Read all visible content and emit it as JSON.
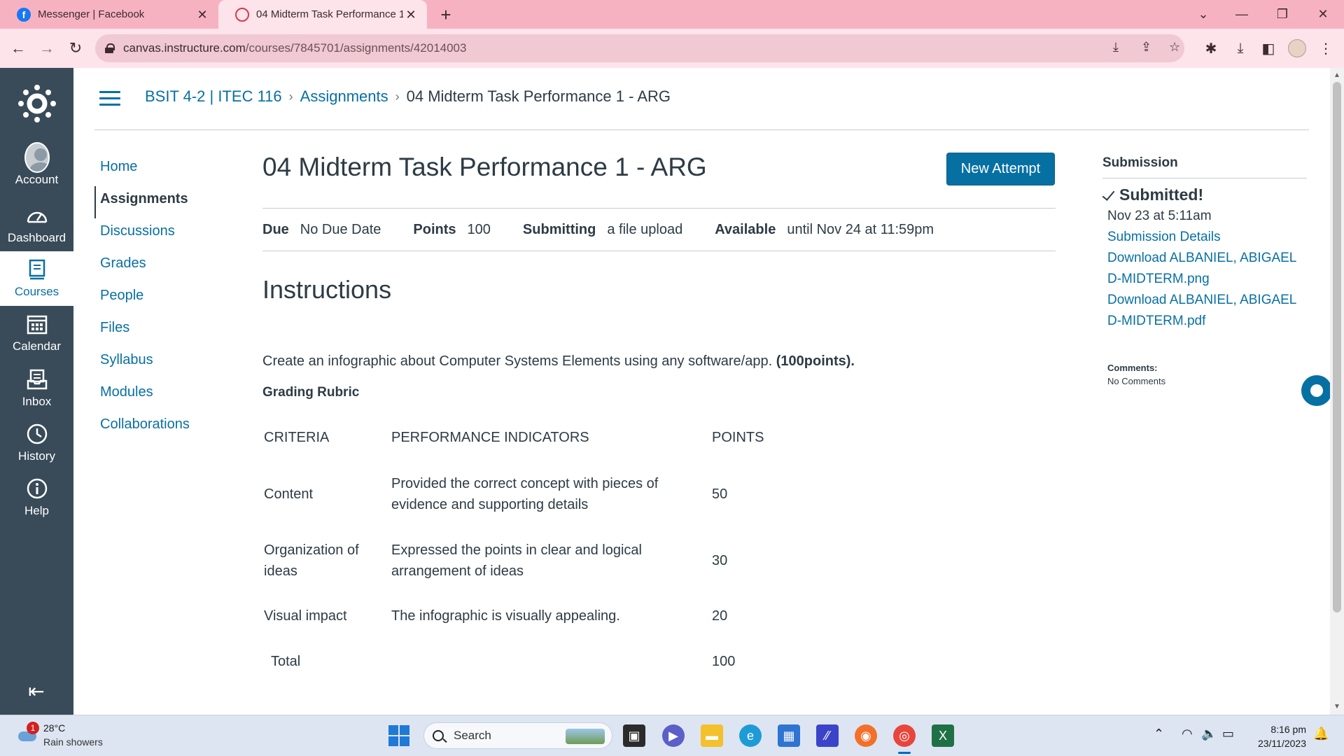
{
  "browser": {
    "tabs": [
      {
        "title": "Messenger | Facebook",
        "active": false,
        "icon": "facebook-icon"
      },
      {
        "title": "04 Midterm Task Performance 1",
        "active": true,
        "icon": "canvas-icon"
      }
    ],
    "url_host": "canvas.instructure.com",
    "url_path": "/courses/7845701/assignments/42014003",
    "accent_color": "#f7b2c2"
  },
  "global_nav": {
    "items": [
      {
        "label": "Account",
        "icon": "user-avatar-icon"
      },
      {
        "label": "Dashboard",
        "icon": "dashboard-icon"
      },
      {
        "label": "Courses",
        "icon": "courses-icon",
        "active": true
      },
      {
        "label": "Calendar",
        "icon": "calendar-icon"
      },
      {
        "label": "Inbox",
        "icon": "inbox-icon"
      },
      {
        "label": "History",
        "icon": "history-icon"
      },
      {
        "label": "Help",
        "icon": "help-icon"
      }
    ],
    "bg_color": "#394b58"
  },
  "breadcrumb": {
    "course": "BSIT 4-2 | ITEC 116",
    "section": "Assignments",
    "current": "04 Midterm Task Performance 1 - ARG",
    "sep": "›"
  },
  "course_nav": [
    {
      "label": "Home"
    },
    {
      "label": "Assignments",
      "active": true
    },
    {
      "label": "Discussions"
    },
    {
      "label": "Grades"
    },
    {
      "label": "People"
    },
    {
      "label": "Files"
    },
    {
      "label": "Syllabus"
    },
    {
      "label": "Modules"
    },
    {
      "label": "Collaborations"
    }
  ],
  "assignment": {
    "title": "04 Midterm Task Performance 1 - ARG",
    "new_attempt_label": "New Attempt",
    "due_label": "Due",
    "due_value": "No Due Date",
    "points_label": "Points",
    "points_value": "100",
    "submitting_label": "Submitting",
    "submitting_value": "a file upload",
    "available_label": "Available",
    "available_value": "until Nov 24 at 11:59pm",
    "instructions_heading": "Instructions",
    "instructions_text": "Create an infographic about Computer Systems Elements using any software/app.",
    "instructions_points": "(100points).",
    "rubric_title": "Grading Rubric",
    "rubric_headers": [
      "CRITERIA",
      "PERFORMANCE INDICATORS",
      "POINTS"
    ],
    "rubric_rows": [
      {
        "criteria": "Content",
        "indicator": "Provided the correct concept with pieces of evidence and supporting details",
        "points": "50"
      },
      {
        "criteria": "Organization of ideas",
        "indicator": "Expressed the points in clear and logical arrangement of ideas",
        "points": "30"
      },
      {
        "criteria": "Visual impact",
        "indicator": "The infographic is visually appealing.",
        "points": "20"
      }
    ],
    "total_label": "Total",
    "total_points": "100"
  },
  "submission": {
    "heading": "Submission",
    "status": "Submitted!",
    "date": "Nov 23 at 5:11am",
    "details_link": "Submission Details",
    "downloads": [
      "Download ALBANIEL, ABIGAEL D-MIDTERM.png",
      "Download ALBANIEL, ABIGAEL D-MIDTERM.pdf"
    ],
    "comments_label": "Comments:",
    "comments_value": "No Comments"
  },
  "taskbar": {
    "weather_temp": "28°C",
    "weather_desc": "Rain showers",
    "weather_badge": "1",
    "search_label": "Search",
    "time": "8:16 pm",
    "date": "23/11/2023"
  }
}
